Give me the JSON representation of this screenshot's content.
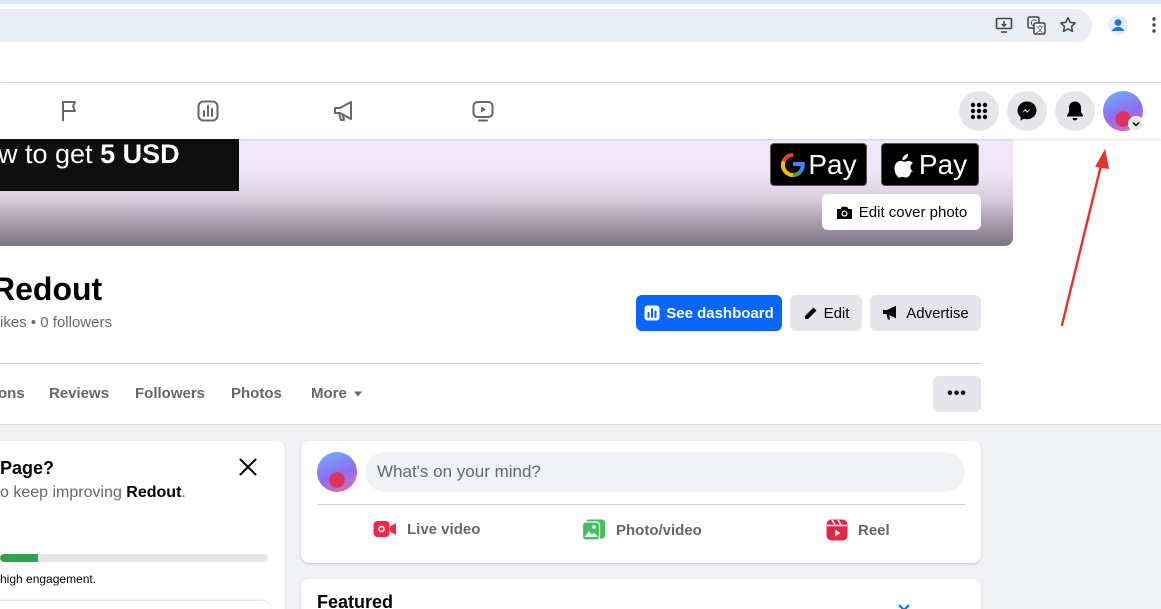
{
  "browser": {
    "icons": [
      "install-app-icon",
      "translate-icon",
      "bookmark-star-icon",
      "profile-icon",
      "kebab-menu-icon"
    ]
  },
  "nav": {
    "tabs": [
      "flag-icon",
      "insights-icon",
      "megaphone-icon",
      "watch-icon"
    ],
    "right_icons": [
      "apps-grid-icon",
      "messenger-icon",
      "notifications-bell-icon",
      "profile-avatar"
    ]
  },
  "cover": {
    "banner_text_prefix": "w to get ",
    "banner_text_bold": "5 USD",
    "gpay_label": "Pay",
    "applepay_label": "Pay",
    "edit_cover_label": "Edit cover photo"
  },
  "page": {
    "name": "Redout",
    "stats": "ikes • 0 followers"
  },
  "actions": {
    "dashboard_label": "See dashboard",
    "edit_label": "Edit",
    "advertise_label": "Advertise"
  },
  "tabs": [
    {
      "label": "ons"
    },
    {
      "label": "Reviews"
    },
    {
      "label": "Followers"
    },
    {
      "label": "Photos"
    },
    {
      "label": "More"
    }
  ],
  "more_dots_label": "•••",
  "left_card": {
    "title": "Page?",
    "subtitle_prefix": "o keep improving ",
    "subtitle_bold": "Redout",
    "subtitle_suffix": ".",
    "progress": 0.14,
    "footer": "high engagement."
  },
  "composer": {
    "placeholder": "What's on your mind?",
    "live_label": "Live video",
    "photo_label": "Photo/video",
    "reel_label": "Reel"
  },
  "featured": {
    "title": "Featured"
  },
  "colors": {
    "accent_blue": "#0866ff",
    "annotation_red": "#e8302c",
    "live_red": "#f02849",
    "photo_green": "#45bd62",
    "reel_pink": "#e42645"
  }
}
